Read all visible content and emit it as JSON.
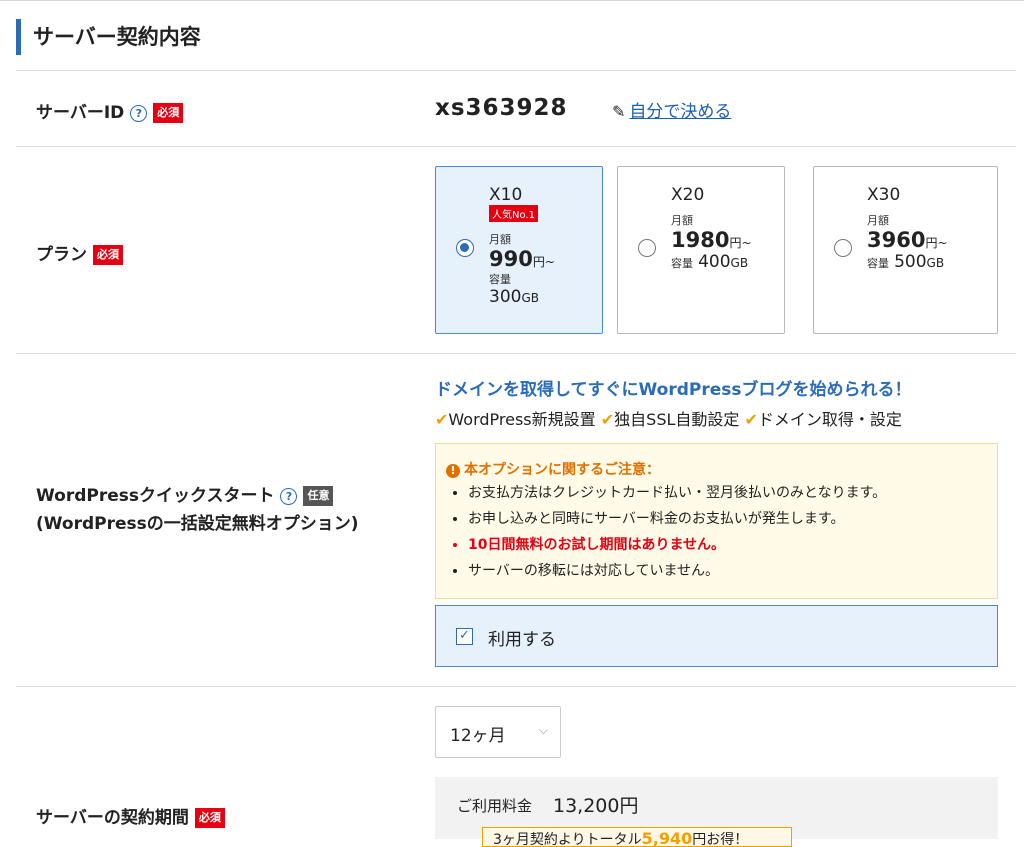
{
  "section_title": "サーバー契約内容",
  "help_icon": "?",
  "server_id": {
    "label": "サーバーID",
    "badge": "必須",
    "value": "xs363928",
    "link": "自分で決める"
  },
  "plan": {
    "label": "プラン",
    "badge": "必須",
    "selected": "X10",
    "options": [
      {
        "name": "X10",
        "popular": "人気No.1",
        "price_label": "月額",
        "price": "990",
        "price_unit": "円~",
        "capacity_label": "容量",
        "capacity": "300",
        "capacity_unit": "GB"
      },
      {
        "name": "X20",
        "price_label": "月額",
        "price": "1980",
        "price_unit": "円~",
        "capacity_label": "容量",
        "capacity": "400",
        "capacity_unit": "GB"
      },
      {
        "name": "X30",
        "price_label": "月額",
        "price": "3960",
        "price_unit": "円~",
        "capacity_label": "容量",
        "capacity": "500",
        "capacity_unit": "GB"
      }
    ]
  },
  "wp_quickstart": {
    "label": "WordPressクイックスタート",
    "badge": "任意",
    "sublabel": "(WordPressの一括設定無料オプション)",
    "headline": "ドメインを取得してすぐにWordPressブログを始められる！",
    "features": [
      "WordPress新規設置",
      "独自SSL自動設定",
      "ドメイン取得・設定"
    ],
    "notice_title": "本オプションに関するご注意：",
    "notice_items": [
      "お支払方法はクレジットカード払い・翌月後払いのみとなります。",
      "お申し込みと同時にサーバー料金のお支払いが発生します。",
      "10日間無料のお試し期間はありません。",
      "サーバーの移転には対応していません。"
    ],
    "use_label": "利用する",
    "use_checked": true
  },
  "contract_period": {
    "label": "サーバーの契約期間",
    "badge": "必須",
    "selected": "12ヶ月",
    "fee_label": "ご利用料金",
    "fee_value": "13,200円",
    "discount_prefix": "3ヶ月契約よりトータル",
    "discount_amount": "5,940",
    "discount_suffix": "円お得！"
  },
  "colors": {
    "accent": "#2b6cb8",
    "required": "#e60012",
    "warning": "#e07000",
    "selected_bg": "#e6f1fc"
  }
}
